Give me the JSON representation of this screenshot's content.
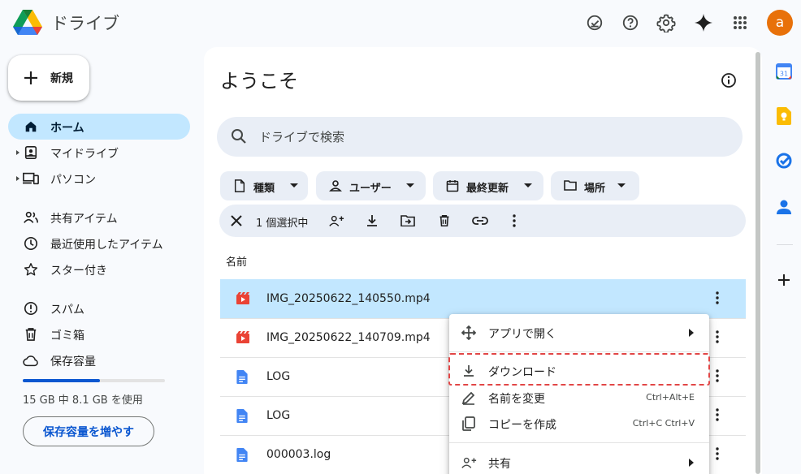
{
  "app": {
    "title": "ドライブ"
  },
  "header_icons": [
    "offline-status-icon",
    "help-icon",
    "settings-icon",
    "gemini-icon",
    "apps-grid-icon"
  ],
  "user": {
    "avatar_letter": "a",
    "avatar_color": "#e8710a"
  },
  "sidebar": {
    "new_label": "新規",
    "items": [
      {
        "label": "ホーム",
        "icon": "home-icon",
        "active": true
      },
      {
        "label": "マイドライブ",
        "icon": "my-drive-icon",
        "expandable": true
      },
      {
        "label": "パソコン",
        "icon": "computers-icon",
        "expandable": true
      },
      {
        "label": "共有アイテム",
        "icon": "shared-icon"
      },
      {
        "label": "最近使用したアイテム",
        "icon": "recent-icon"
      },
      {
        "label": "スター付き",
        "icon": "star-icon"
      },
      {
        "label": "スパム",
        "icon": "spam-icon"
      },
      {
        "label": "ゴミ箱",
        "icon": "trash-icon"
      },
      {
        "label": "保存容量",
        "icon": "cloud-icon"
      }
    ],
    "storage": {
      "text": "15 GB 中 8.1 GB を使用",
      "used_fraction": 0.54,
      "button": "保存容量を増やす"
    }
  },
  "main": {
    "title": "ようこそ",
    "search_placeholder": "ドライブで検索",
    "filters": [
      {
        "label": "種類",
        "icon": "file-icon"
      },
      {
        "label": "ユーザー",
        "icon": "person-icon"
      },
      {
        "label": "最終更新",
        "icon": "calendar-icon"
      },
      {
        "label": "場所",
        "icon": "folder-icon"
      }
    ],
    "selection": {
      "label": "1 個選択中"
    },
    "column_header": "名前",
    "files": [
      {
        "name": "IMG_20250622_140550.mp4",
        "type": "video",
        "selected": true
      },
      {
        "name": "IMG_20250622_140709.mp4",
        "type": "video"
      },
      {
        "name": "LOG",
        "type": "doc"
      },
      {
        "name": "LOG",
        "type": "doc"
      },
      {
        "name": "000003.log",
        "type": "doc"
      }
    ]
  },
  "context_menu": {
    "items": [
      {
        "label": "アプリで開く",
        "icon": "open-with-icon",
        "submenu": true
      },
      {
        "label": "ダウンロード",
        "icon": "download-icon",
        "highlighted": true
      },
      {
        "label": "名前を変更",
        "icon": "rename-icon",
        "shortcut": "Ctrl+Alt+E"
      },
      {
        "label": "コピーを作成",
        "icon": "copy-icon",
        "shortcut": "Ctrl+C Ctrl+V"
      },
      {
        "label": "共有",
        "icon": "share-icon",
        "submenu": true
      }
    ]
  },
  "right_rail": [
    "calendar-app-icon",
    "keep-app-icon",
    "tasks-app-icon",
    "contacts-app-icon",
    "add-addon-icon"
  ],
  "colors": {
    "accent": "#0b57d0",
    "selected_bg": "#c2e7ff",
    "highlight_border": "#e24646"
  }
}
